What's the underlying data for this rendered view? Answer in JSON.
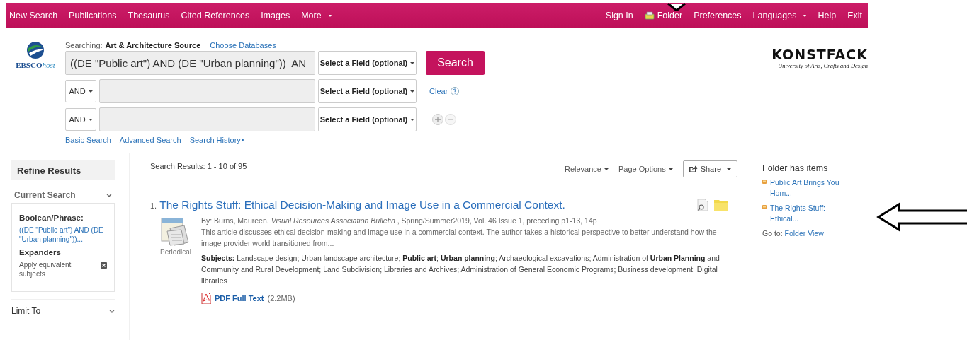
{
  "top_nav": {
    "left": [
      {
        "label": "New Search",
        "dropdown": false
      },
      {
        "label": "Publications",
        "dropdown": false
      },
      {
        "label": "Thesaurus",
        "dropdown": false
      },
      {
        "label": "Cited References",
        "dropdown": false
      },
      {
        "label": "Images",
        "dropdown": false
      },
      {
        "label": "More",
        "dropdown": true
      }
    ],
    "right": [
      {
        "label": "Sign In",
        "kind": "link",
        "dropdown": false
      },
      {
        "label": "Folder",
        "kind": "folder",
        "dropdown": false
      },
      {
        "label": "Preferences",
        "kind": "link",
        "dropdown": false
      },
      {
        "label": "Languages",
        "kind": "link",
        "dropdown": true
      },
      {
        "label": "Help",
        "kind": "link",
        "dropdown": false
      },
      {
        "label": "Exit",
        "kind": "link",
        "dropdown": false
      }
    ]
  },
  "brand": {
    "logo_main": "EBSCO",
    "logo_suffix": "host"
  },
  "institution": {
    "name": "KONSTFACK",
    "tagline": "University of Arts, Crafts and Design"
  },
  "search": {
    "searching_label": "Searching:",
    "database": "Art & Architecture Source",
    "choose_link": "Choose Databases",
    "rows": [
      {
        "kind": "first",
        "value": "((DE \"Public art\") AND (DE \"Urban planning\"))  AN",
        "field": "Select a Field (optional)"
      },
      {
        "kind": "more",
        "operator": "AND",
        "value": "",
        "field": "Select a Field (optional)"
      },
      {
        "kind": "more",
        "operator": "AND",
        "value": "",
        "field": "Select a Field (optional)"
      }
    ],
    "search_button": "Search",
    "clear_link": "Clear",
    "links": [
      "Basic Search",
      "Advanced Search",
      "Search History"
    ]
  },
  "sidebar": {
    "title": "Refine Results",
    "current_search": {
      "title": "Current Search",
      "expanded": true,
      "boolean_heading": "Boolean/Phrase:",
      "query": "((DE \"Public art\") AND (DE \"Urban planning\"))...",
      "expanders_heading": "Expanders",
      "expander": "Apply equivalent subjects"
    },
    "limit_to": {
      "title": "Limit To",
      "expanded": false
    }
  },
  "results": {
    "summary_label": "Search Results:",
    "summary": "1 - 10 of 95",
    "sort": "Relevance",
    "page_options": "Page Options",
    "share": "Share",
    "items": [
      {
        "number": "1.",
        "title": "The Rights Stuff: Ethical Decision-Making and Image Use in a Commercial Context.",
        "type": "Periodical",
        "citation": "By: Burns, Maureen. *Visual Resources Association Bulletin* , Spring/Summer2019, Vol. 46 Issue 1, preceding p1-13, 14p",
        "abstract": "This article discusses ethical decision-making and image use in a commercial context. The author takes a historical perspective to better understand how the image provider world transitioned from...",
        "subjects": "**Subjects:** Landscape design; Urban landscape architecture; **Public art**; **Urban planning**; Archaeological excavations; Administration of **Urban Planning** and Community and Rural Development; Land Subdivision; Libraries and Archives; Administration of General Economic Programs; Business development; Digital libraries",
        "full_text": "PDF Full Text",
        "full_text_size": "(2.2MB)"
      }
    ]
  },
  "folder": {
    "title": "Folder has items",
    "items": [
      "Public Art Brings You Hom...",
      "The Rights Stuff: Ethical..."
    ],
    "goto_label": "Go to:",
    "goto_link": "Folder View"
  }
}
